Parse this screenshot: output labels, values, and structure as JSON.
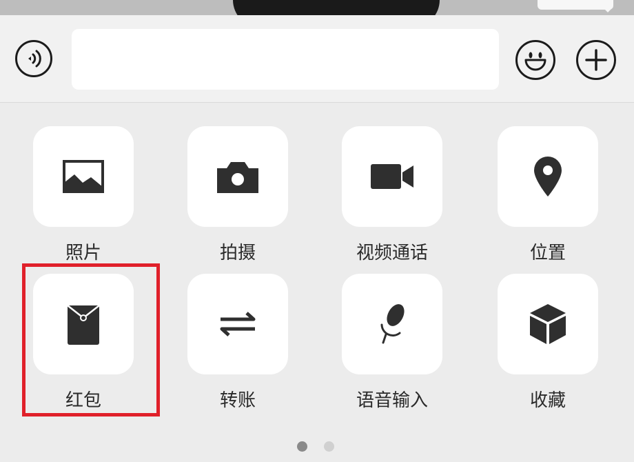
{
  "input_bar": {
    "voice_icon": "voice-icon",
    "emoji_icon": "emoji-icon",
    "add_icon": "plus-icon",
    "text_value": ""
  },
  "actions": [
    {
      "label": "照片",
      "icon": "photo-icon"
    },
    {
      "label": "拍摄",
      "icon": "camera-icon"
    },
    {
      "label": "视频通话",
      "icon": "video-call-icon"
    },
    {
      "label": "位置",
      "icon": "location-icon"
    },
    {
      "label": "红包",
      "icon": "red-packet-icon"
    },
    {
      "label": "转账",
      "icon": "transfer-icon"
    },
    {
      "label": "语音输入",
      "icon": "microphone-icon"
    },
    {
      "label": "收藏",
      "icon": "favorites-icon"
    }
  ],
  "pager": {
    "current": 1,
    "total": 2
  },
  "colors": {
    "highlight": "#e0202a",
    "icon": "#2f2f2f",
    "tile": "#ffffff"
  }
}
